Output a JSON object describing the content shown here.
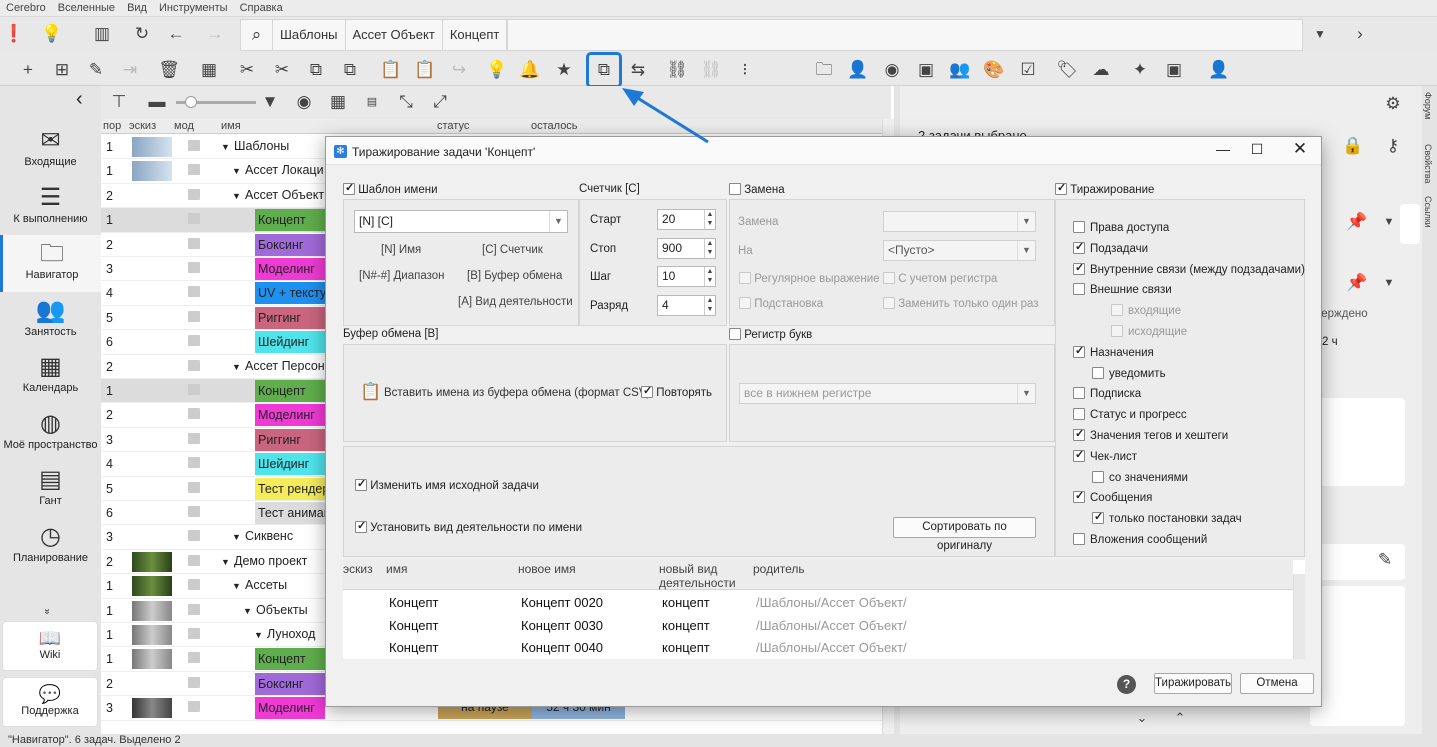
{
  "menu": [
    "Cerebro",
    "Вселенные",
    "Вид",
    "Инструменты",
    "Справка"
  ],
  "tabs": [
    "Шаблоны",
    "Ассет Объект",
    "Концепт"
  ],
  "sidebar": [
    {
      "label": "Входящие",
      "icon": "mail-icon",
      "glyph": "✉"
    },
    {
      "label": "К выполнению",
      "icon": "list-icon",
      "glyph": "☰"
    },
    {
      "label": "Навигатор",
      "icon": "folder-icon",
      "glyph": "🗀"
    },
    {
      "label": "Занятость",
      "icon": "people-icon",
      "glyph": "👥"
    },
    {
      "label": "Календарь",
      "icon": "calendar-icon",
      "glyph": "▦"
    },
    {
      "label": "Моё пространство",
      "icon": "globe-icon",
      "glyph": "◍"
    },
    {
      "label": "Гант",
      "icon": "gantt-icon",
      "glyph": "▤"
    },
    {
      "label": "Планирование",
      "icon": "clock-plus-icon",
      "glyph": "◷"
    }
  ],
  "sidebar_bottom": {
    "wiki": "Wiki",
    "support": "Поддержка"
  },
  "tree": {
    "columns": [
      "пор",
      "эскиз",
      "мод",
      "имя",
      "статус",
      "осталось"
    ],
    "rows": [
      {
        "n": "1",
        "name": "Шаблоны",
        "indent": 0,
        "thumb": "plane"
      },
      {
        "n": "1",
        "name": "Ассет Локаци",
        "indent": 1,
        "thumb": "plane"
      },
      {
        "n": "2",
        "name": "Ассет Объект",
        "indent": 1,
        "thumb": ""
      },
      {
        "n": "1",
        "task": "Концепт",
        "color": "#5fad4c",
        "sel": true
      },
      {
        "n": "2",
        "task": "Боксинг",
        "color": "#a06ad8"
      },
      {
        "n": "3",
        "task": "Моделинг",
        "color": "#f03ad6"
      },
      {
        "n": "4",
        "task": "UV + текстур",
        "color": "#1e90f0"
      },
      {
        "n": "5",
        "task": "Риггинг",
        "color": "#c9657f"
      },
      {
        "n": "6",
        "task": "Шейдинг",
        "color": "#4fe4ec"
      },
      {
        "n": "2",
        "name": "Ассет Персон",
        "indent": 1,
        "thumb": ""
      },
      {
        "n": "1",
        "task": "Концепт",
        "color": "#5fad4c",
        "sel": true
      },
      {
        "n": "2",
        "task": "Моделинг",
        "color": "#f03ad6"
      },
      {
        "n": "3",
        "task": "Риггинг",
        "color": "#c9657f"
      },
      {
        "n": "4",
        "task": "Шейдинг",
        "color": "#4fe4ec"
      },
      {
        "n": "5",
        "task": "Тест рендер",
        "color": "#f4ec5a"
      },
      {
        "n": "6",
        "task": "Тест аниман",
        "color": "#dcdcdc"
      },
      {
        "n": "3",
        "name": "Сиквенс",
        "indent": 1,
        "thumb": ""
      },
      {
        "n": "2",
        "name": "Демо проект",
        "indent": 0,
        "thumb": "forest"
      },
      {
        "n": "1",
        "name": "Ассеты",
        "indent": 1,
        "thumb": "forest"
      },
      {
        "n": "1",
        "name": "Объекты",
        "indent": 2,
        "thumb": "gray"
      },
      {
        "n": "1",
        "name": "Луноход",
        "indent": 3,
        "thumb": "gray"
      },
      {
        "n": "1",
        "task": "Концепт",
        "color": "#5fad4c",
        "thumb": "gray"
      },
      {
        "n": "2",
        "task": "Боксинг",
        "color": "#a06ad8"
      },
      {
        "n": "3",
        "task": "Моделинг",
        "color": "#f03ad6",
        "thumb": "moon",
        "status": "на паузе",
        "left": "52 ч 30 мин"
      }
    ]
  },
  "right_panel": {
    "header": "2 задачи выбрано",
    "confirmed": "тверждено",
    "hours": "2 ч",
    "side_tabs": [
      "Форум",
      "Свойства",
      "Ссылки"
    ]
  },
  "status_bar": "\"Навигатор\". 6 задач. Выделено 2",
  "dialog": {
    "title": "Тиражирование задачи 'Концепт'",
    "name_template": {
      "label": "Шаблон имени",
      "checked": true,
      "value": "[N] [C]",
      "hints": [
        "[N] Имя",
        "[C] Счетчик",
        "[N#-#] Диапазон",
        "[B] Буфер обмена",
        "[A] Вид деятельности"
      ]
    },
    "counter": {
      "label": "Счетчик [C]",
      "fields": [
        {
          "label": "Старт",
          "value": "20"
        },
        {
          "label": "Стоп",
          "value": "900"
        },
        {
          "label": "Шаг",
          "value": "10"
        },
        {
          "label": "Разряд",
          "value": "4"
        }
      ]
    },
    "replace": {
      "label": "Замена",
      "checked": false,
      "replace_label": "Замена",
      "to_label": "На",
      "to_value": "<Пусто>",
      "regex": "Регулярное выражение",
      "case": "С учетом регистра",
      "substitution": "Подстановка",
      "once": "Заменить только один раз"
    },
    "clipboard": {
      "label": "Буфер обмена [B]",
      "paste": "Вставить имена из буфера обмена (формат CSV)",
      "repeat": "Повторять",
      "repeat_checked": true
    },
    "letter_case": {
      "label": "Регистр букв",
      "checked": false,
      "value": "все в нижнем регистре"
    },
    "options": {
      "rename_source": "Изменить имя исходной задачи",
      "set_activity": "Установить вид деятельности по имени",
      "sort_button": "Сортировать по оригиналу"
    },
    "replication": {
      "label": "Тиражирование",
      "checked": true,
      "items": [
        {
          "label": "Права доступа",
          "checked": false,
          "level": 0
        },
        {
          "label": "Подзадачи",
          "checked": true,
          "level": 0
        },
        {
          "label": "Внутренние связи (между подзадачами)",
          "checked": true,
          "level": 0
        },
        {
          "label": "Внешние связи",
          "checked": false,
          "level": 0
        },
        {
          "label": "входящие",
          "checked": false,
          "level": 2,
          "disabled": true
        },
        {
          "label": "исходящие",
          "checked": false,
          "level": 2,
          "disabled": true
        },
        {
          "label": "Назначения",
          "checked": true,
          "level": 0
        },
        {
          "label": "уведомить",
          "checked": false,
          "level": 1
        },
        {
          "label": "Подписка",
          "checked": false,
          "level": 0
        },
        {
          "label": "Статус и прогресс",
          "checked": false,
          "level": 0
        },
        {
          "label": "Значения тегов и хештеги",
          "checked": true,
          "level": 0
        },
        {
          "label": "Чек-лист",
          "checked": true,
          "level": 0
        },
        {
          "label": "со значениями",
          "checked": false,
          "level": 1
        },
        {
          "label": "Сообщения",
          "checked": true,
          "level": 0
        },
        {
          "label": "только постановки задач",
          "checked": true,
          "level": 1
        },
        {
          "label": "Вложения сообщений",
          "checked": false,
          "level": 0
        }
      ]
    },
    "grid": {
      "columns": [
        "эскиз",
        "имя",
        "новое имя",
        "новый вид деятельности",
        "родитель"
      ],
      "rows": [
        {
          "name": "Концепт",
          "new_name": "Концепт 0020",
          "activity": "концепт",
          "parent": "/Шаблоны/Ассет Объект/"
        },
        {
          "name": "Концепт",
          "new_name": "Концепт 0030",
          "activity": "концепт",
          "parent": "/Шаблоны/Ассет Объект/"
        },
        {
          "name": "Концепт",
          "new_name": "Концепт 0040",
          "activity": "концепт",
          "parent": "/Шаблоны/Ассет Объект/"
        }
      ]
    },
    "buttons": {
      "help": "?",
      "replicate": "Тиражировать",
      "cancel": "Отмена"
    }
  },
  "accent_color": "#1e78d6"
}
